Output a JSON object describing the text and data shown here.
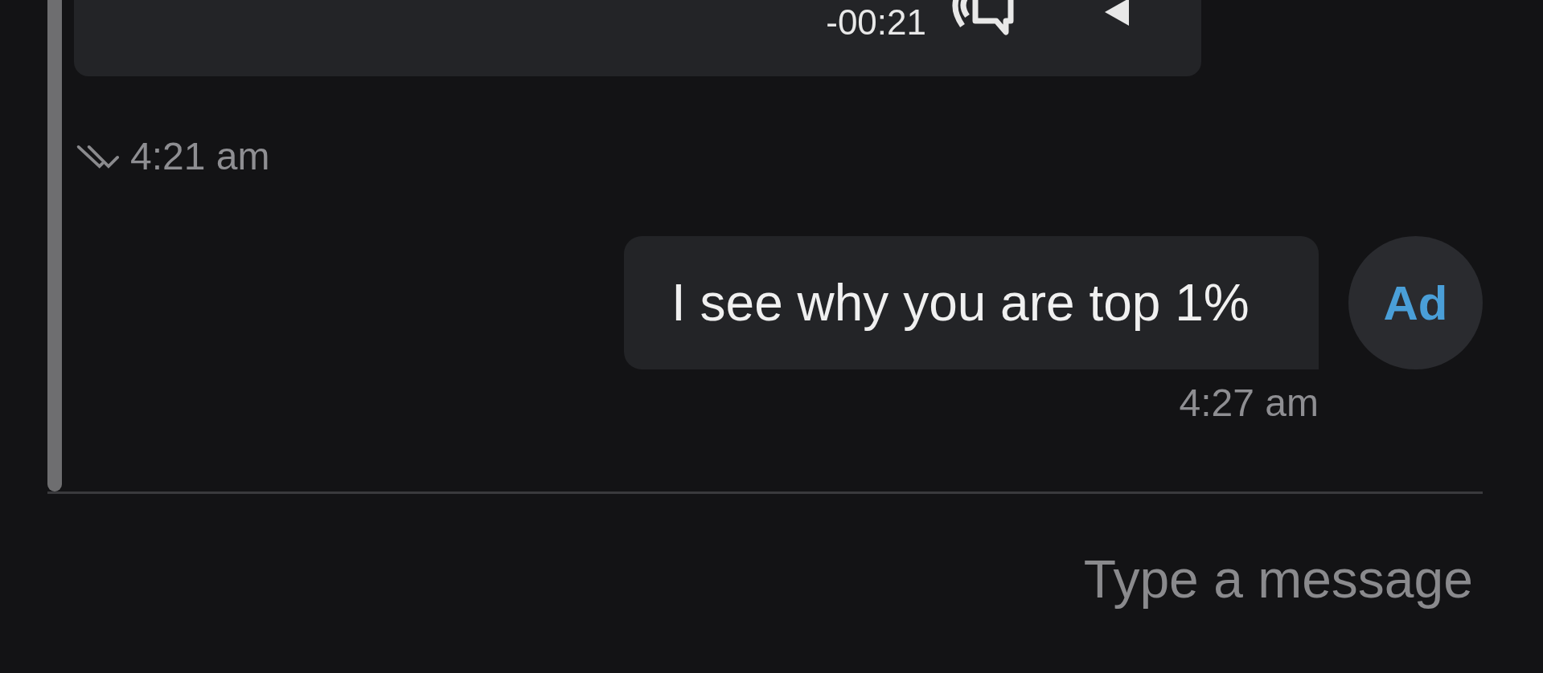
{
  "audio_message": {
    "remaining": "-00:21",
    "time": "4:21 am",
    "read": true
  },
  "messages": [
    {
      "sender_initials": "Ad",
      "text": "I see why you are top 1%",
      "time": "4:27 am"
    }
  ],
  "composer": {
    "placeholder": "Type a message"
  }
}
